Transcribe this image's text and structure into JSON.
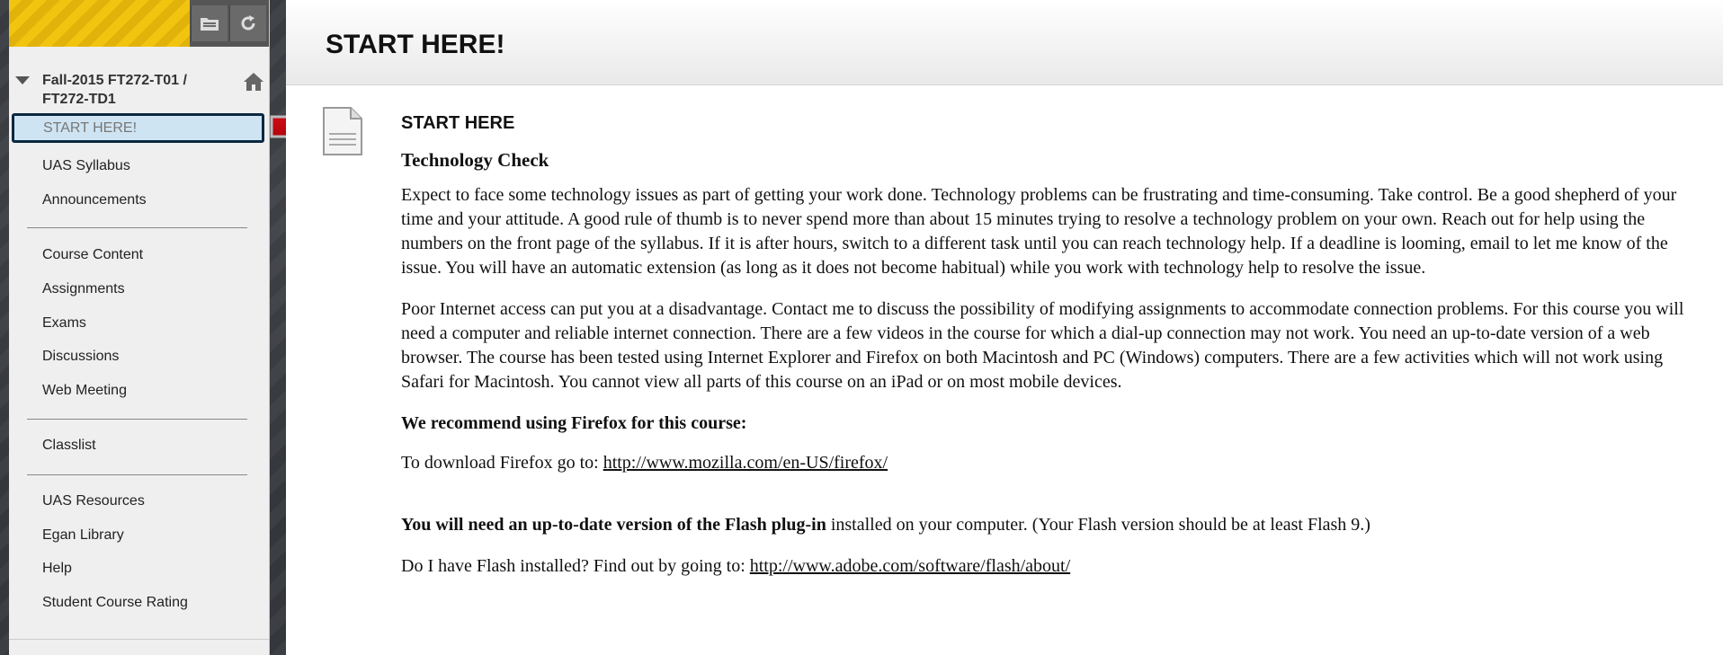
{
  "sidebar": {
    "course_title": "Fall-2015 FT272-T01 / FT272-TD1",
    "items": [
      {
        "label": "START HERE!"
      },
      {
        "label": "UAS Syllabus"
      },
      {
        "label": "Announcements"
      },
      {
        "label": "Course Content"
      },
      {
        "label": "Assignments"
      },
      {
        "label": "Exams"
      },
      {
        "label": "Discussions"
      },
      {
        "label": "Web Meeting"
      },
      {
        "label": "Classlist"
      },
      {
        "label": "UAS Resources"
      },
      {
        "label": "Egan Library"
      },
      {
        "label": "Help"
      },
      {
        "label": "Student Course Rating"
      }
    ],
    "icons": [
      "folder-icon",
      "refresh-icon",
      "home-icon",
      "collapse-triangle-icon"
    ]
  },
  "main": {
    "page_title": "START HERE!",
    "item_title": "START HERE",
    "section_heading": "Technology Check",
    "para1": "Expect to face some technology issues as part of getting your work done. Technology problems can be frustrating and time-consuming. Take control. Be a good shepherd of your time and your attitude. A good rule of thumb is to never spend more than about 15 minutes trying to resolve a technology problem on your own.  Reach out for help using the numbers on the front page of the syllabus. If it is after hours, switch to a different task until you can reach technology help. If a deadline is looming, email to let me know of the issue. You will have an automatic extension (as long as it does not become habitual) while you work with technology help to resolve the issue.",
    "para2": "Poor Internet access can put you at a disadvantage. Contact me to discuss the possibility of modifying assignments to accommodate connection problems. For this course you will need a computer and reliable internet connection.  There are a few videos in the course for which a dial-up connection may not work. You need an up-to-date version of a web browser. The course has been tested using Internet Explorer and Firefox on both Macintosh and PC (Windows) computers. There are a few activities which will not work using Safari for Macintosh. You cannot view all parts of this course on an iPad or on most mobile devices.",
    "firefox_heading": "We recommend using Firefox for this course:",
    "firefox_prefix": "To download Firefox go to: ",
    "firefox_link": "http://www.mozilla.com/en-US/firefox/",
    "flash_bold": "You will need an up-to-date version of the Flash plug-in",
    "flash_rest": " installed on your computer.  (Your Flash version should be at least Flash 9.)",
    "flash_check_prefix": "Do I have Flash installed?  Find out by going to: ",
    "flash_link": "http://www.adobe.com/software/flash/about/"
  },
  "colors": {
    "accent_stripe": "#f1c40f",
    "active_bg": "#cfe4f2",
    "active_border": "#0b2841",
    "arrow": "#c0000a"
  }
}
